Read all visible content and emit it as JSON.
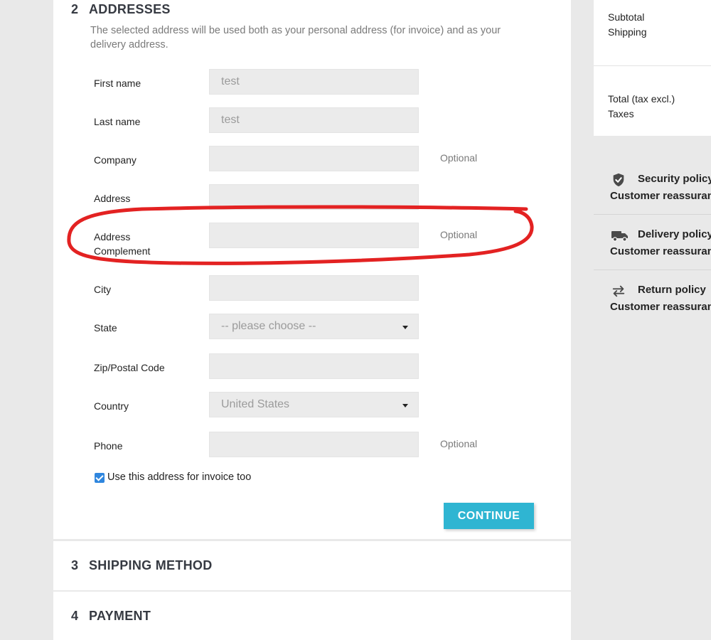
{
  "checkout": {
    "addresses": {
      "number": "2",
      "title": "ADDRESSES",
      "description": "The selected address will be used both as your personal address (for invoice) and as your delivery address.",
      "fields": {
        "first_name": {
          "label": "First name",
          "value": "test"
        },
        "last_name": {
          "label": "Last name",
          "value": "test"
        },
        "company": {
          "label": "Company",
          "value": "",
          "note": "Optional"
        },
        "address": {
          "label": "Address",
          "value": ""
        },
        "address_complement": {
          "label": "Address Complement",
          "value": "",
          "note": "Optional"
        },
        "city": {
          "label": "City",
          "value": ""
        },
        "state": {
          "label": "State",
          "value": "-- please choose --"
        },
        "zip": {
          "label": "Zip/Postal Code",
          "value": ""
        },
        "country": {
          "label": "Country",
          "value": "United States"
        },
        "phone": {
          "label": "Phone",
          "value": "",
          "note": "Optional"
        }
      },
      "use_for_invoice": {
        "checked": true,
        "label": "Use this address for invoice too"
      },
      "continue_label": "CONTINUE"
    },
    "shipping": {
      "number": "3",
      "title": "SHIPPING METHOD"
    },
    "payment": {
      "number": "4",
      "title": "PAYMENT"
    }
  },
  "summary": {
    "subtotal_label": "Subtotal",
    "shipping_label": "Shipping",
    "total_label": "Total (tax excl.)",
    "taxes_label": "Taxes"
  },
  "reassurance": [
    {
      "icon": "shield-icon",
      "title": "Security policy",
      "subtitle": "Customer reassurance"
    },
    {
      "icon": "truck-icon",
      "title": "Delivery policy",
      "subtitle": "Customer reassurance"
    },
    {
      "icon": "swap-arrows-icon",
      "title": "Return policy",
      "subtitle": "Customer reassurance"
    }
  ],
  "colors": {
    "accent": "#2fb5d2",
    "checkbox": "#2f86de",
    "annotation": "#e32222",
    "background": "#e9e9e9"
  }
}
